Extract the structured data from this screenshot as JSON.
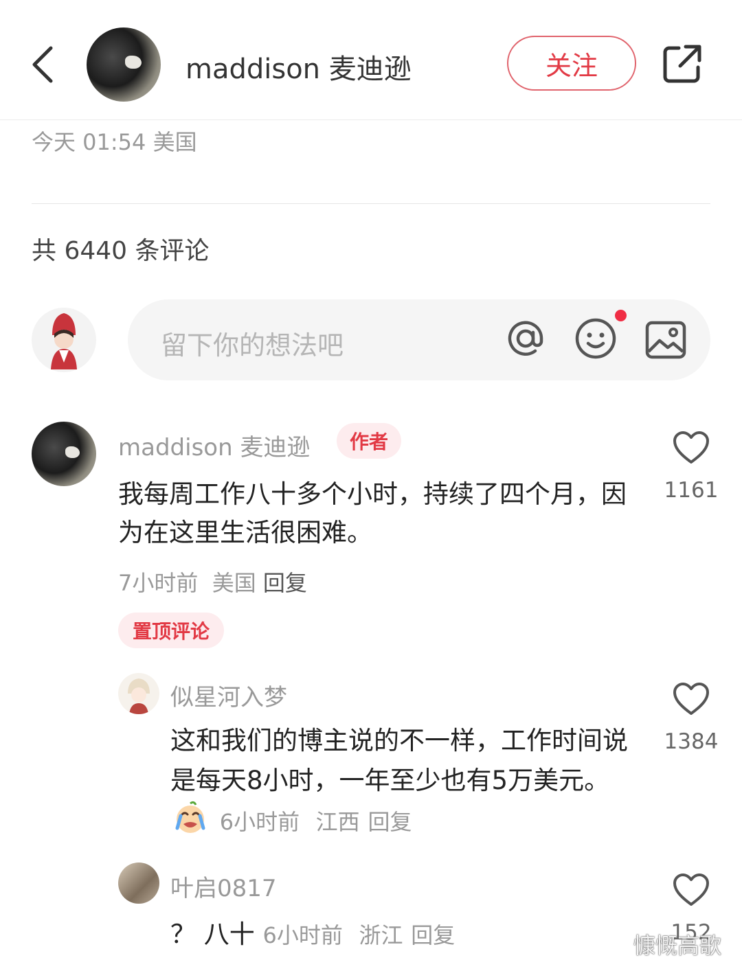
{
  "header": {
    "back_icon": "chevron-left-icon",
    "author_name": "maddison 麦迪逊",
    "follow_label": "关注",
    "share_icon": "share-icon"
  },
  "post": {
    "meta": "今天 01:54 美国"
  },
  "comments_section": {
    "total_label": "共 6440 条评论",
    "input": {
      "placeholder": "留下你的想法吧",
      "icons": [
        "at-icon",
        "emoji-icon",
        "image-icon"
      ]
    },
    "comments": [
      {
        "user": "maddison 麦迪逊",
        "badge": "作者",
        "text": "我每周工作八十多个小时，持续了四个月，因为在这里生活很困难。",
        "time": "7小时前",
        "location": "美国",
        "reply_label": "回复",
        "pinned_label": "置顶评论",
        "likes": "1161"
      },
      {
        "user": "似星河入梦",
        "text": "这和我们的博主说的不一样，工作时间说是每天8小时，一年至少也有5万美元。",
        "time": "6小时前",
        "location": "江西",
        "reply_label": "回复",
        "likes": "1384"
      },
      {
        "user": "叶启0817",
        "text": "？ 八十",
        "time": "6小时前",
        "location": "浙江",
        "reply_label": "回复",
        "likes": "152"
      }
    ]
  },
  "watermark": "慷慨高歌",
  "colors": {
    "accent_red": "#e23a45",
    "badge_bg": "#fdecee",
    "muted_text": "#999999"
  }
}
